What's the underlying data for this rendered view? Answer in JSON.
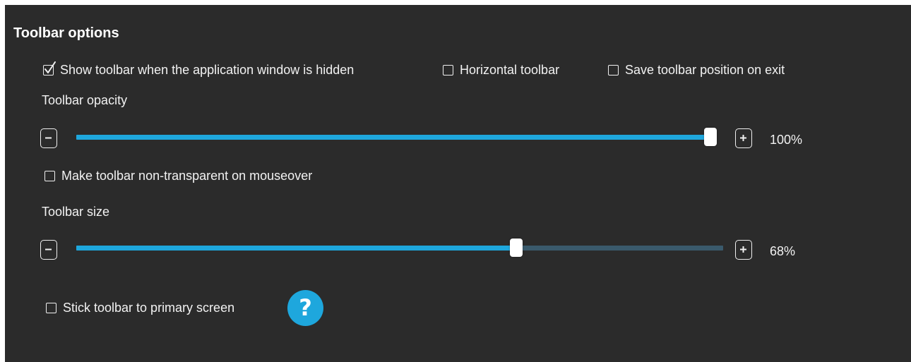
{
  "section_title": "Toolbar options",
  "checkboxes": {
    "show_when_hidden": {
      "label": "Show toolbar when the application window is hidden",
      "checked": true
    },
    "horizontal": {
      "label": "Horizontal toolbar",
      "checked": false
    },
    "save_position": {
      "label": "Save toolbar position on exit",
      "checked": false
    },
    "non_transparent": {
      "label": "Make toolbar non-transparent on mouseover",
      "checked": false
    },
    "stick_primary": {
      "label": "Stick toolbar to primary screen",
      "checked": false
    }
  },
  "opacity": {
    "label": "Toolbar opacity",
    "value": 100,
    "value_text": "100%"
  },
  "size": {
    "label": "Toolbar size",
    "value": 68,
    "value_text": "68%"
  },
  "help": {
    "glyph": "?",
    "icon": "question-mark-icon"
  },
  "colors": {
    "panel_bg": "#2b2b2b",
    "accent": "#1ea7dd",
    "track_empty": "#3a5a6c",
    "text": "#f2f2f2"
  }
}
